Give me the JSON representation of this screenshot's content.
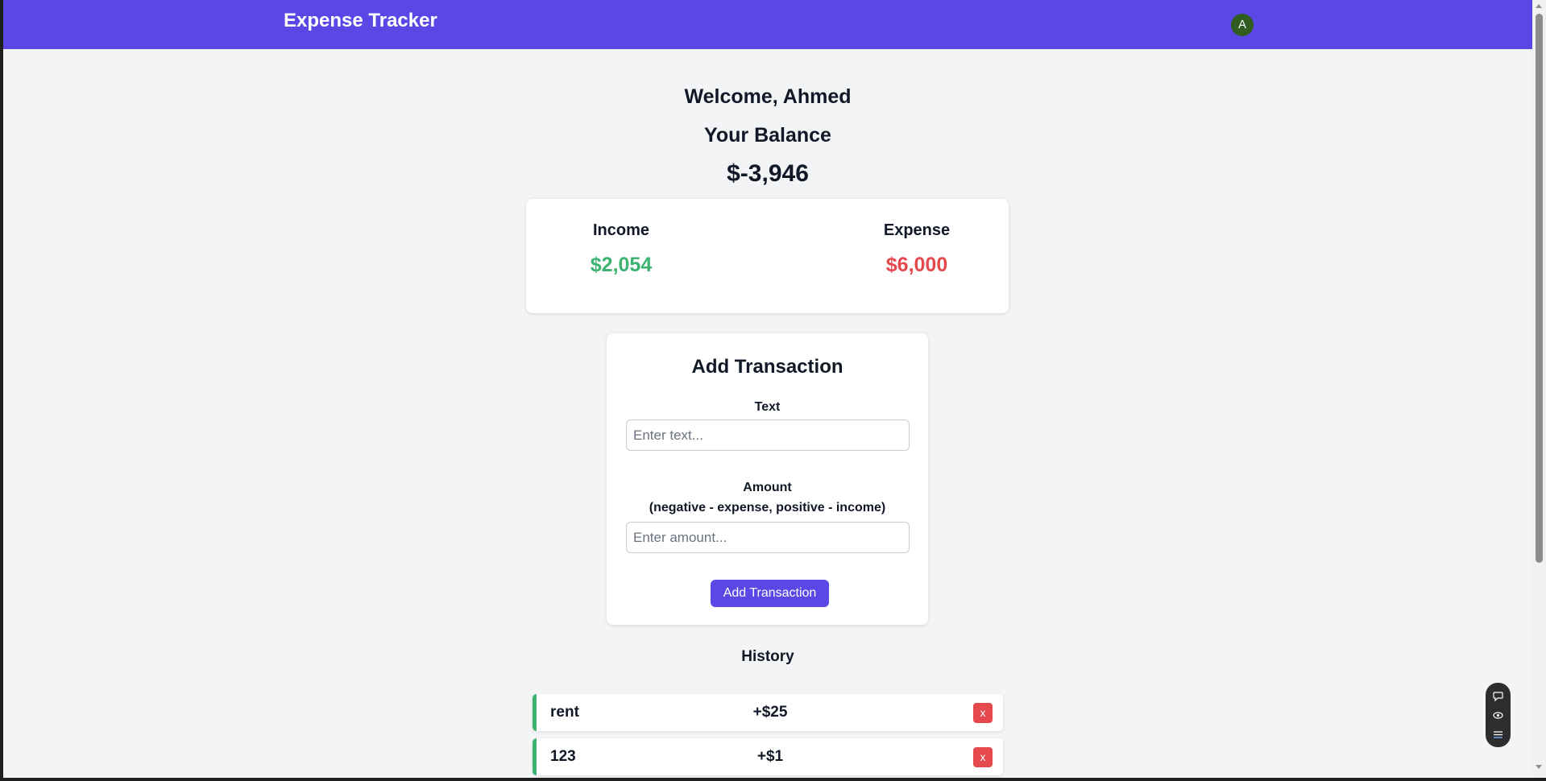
{
  "app": {
    "title": "Expense Tracker",
    "avatar_initial": "A",
    "accent_color": "#5b47e5"
  },
  "summary": {
    "welcome": "Welcome, Ahmed",
    "balance_label": "Your Balance",
    "balance_value": "$-3,946",
    "income_label": "Income",
    "income_value": "$2,054",
    "expense_label": "Expense",
    "expense_value": "$6,000",
    "income_color": "#3cb371",
    "expense_color": "#e5484d"
  },
  "form": {
    "title": "Add Transaction",
    "text_label": "Text",
    "text_placeholder": "Enter text...",
    "amount_label": "Amount",
    "amount_hint": "(negative - expense, positive - income)",
    "amount_placeholder": "Enter amount...",
    "submit_label": "Add Transaction"
  },
  "history": {
    "title": "History",
    "items": [
      {
        "text": "rent",
        "amount": "+$25",
        "delete_label": "x"
      },
      {
        "text": "123",
        "amount": "+$1",
        "delete_label": "x"
      }
    ]
  },
  "toolbar": {
    "icons": [
      "chat-icon",
      "eye-icon",
      "list-icon"
    ]
  }
}
